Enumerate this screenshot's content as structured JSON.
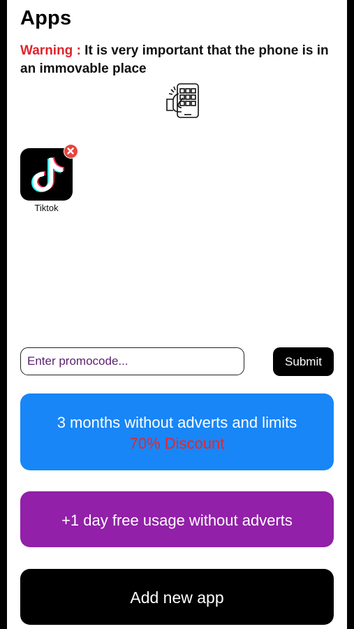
{
  "header": {
    "title": "Apps",
    "warning_label": "Warning :",
    "warning_text": " It is very important that the phone is in an immovable place",
    "illustration_icon": "hand-holding-phone-icon"
  },
  "apps": [
    {
      "label": "Tiktok",
      "icon": "tiktok-logo-icon",
      "remove_icon": "remove-icon"
    }
  ],
  "promo": {
    "placeholder": "Enter promocode...",
    "submit_label": "Submit"
  },
  "offers": {
    "premium_line1": "3 months without adverts and limits",
    "premium_line2": "70% Discount",
    "free_day": "+1 day free usage without adverts"
  },
  "actions": {
    "add_app": "Add new app"
  },
  "colors": {
    "warning": "#e0242b",
    "premium_bg": "#1886f7",
    "discount": "#e8242c",
    "free_day_bg": "#9220a8",
    "remove_badge": "#e8453c"
  }
}
